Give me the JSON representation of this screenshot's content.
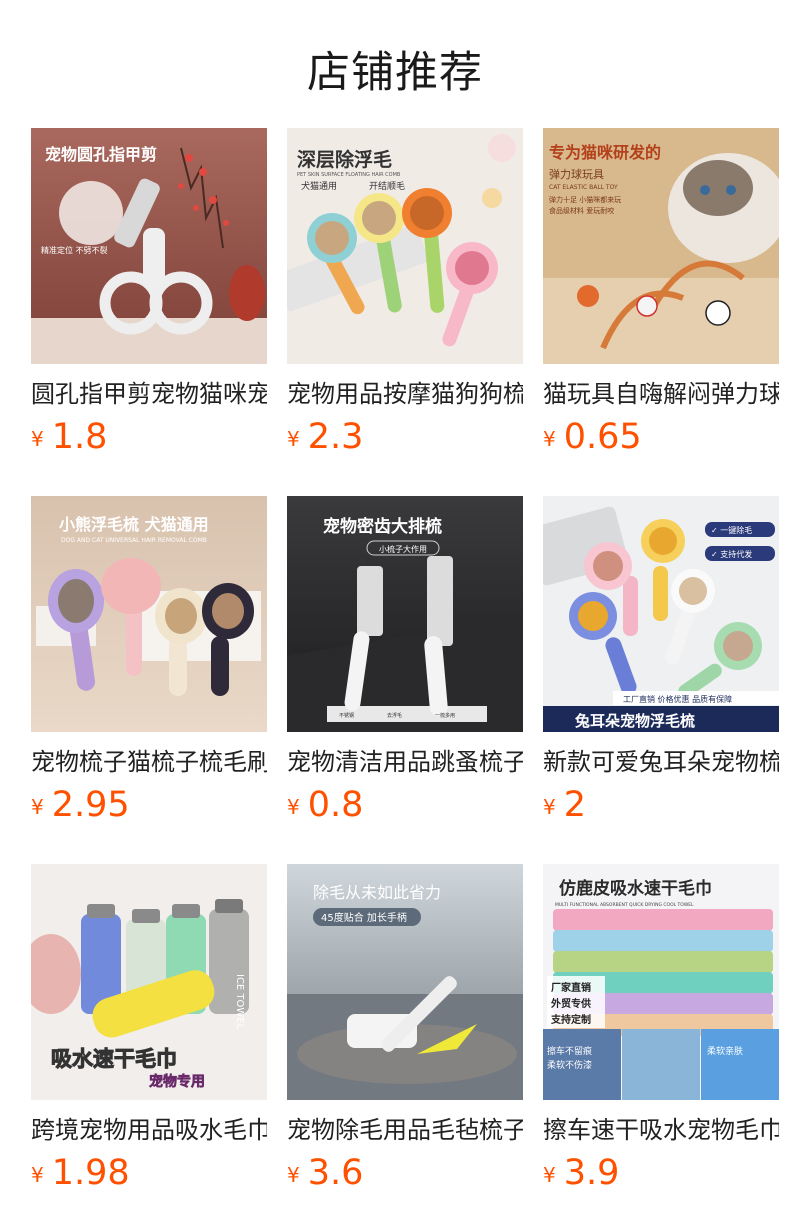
{
  "header": {
    "title": "店铺推荐"
  },
  "currency_symbol": "¥",
  "colors": {
    "price": "#ff5000"
  },
  "products": [
    {
      "name": "圆孔指甲剪宠物猫咪宠物用品",
      "price": "1.8",
      "image_text": [
        "宠物圆孔指甲剪",
        "精准定位 不劈不裂"
      ]
    },
    {
      "name": "宠物用品按摩猫狗狗梳子",
      "price": "2.3",
      "image_text": [
        "深层除浮毛",
        "PET SKIN SURFACE FLOATING HAIR COMB",
        "犬猫通用",
        "开结顺毛"
      ]
    },
    {
      "name": "猫玩具自嗨解闷弹力球",
      "price": "0.65",
      "image_text": [
        "专为猫咪研发的",
        "弹力球玩具",
        "CAT ELASTIC BALL TOY",
        "弹力十足 小猫咪都来玩",
        "食品级材料 爱玩耐咬"
      ]
    },
    {
      "name": "宠物梳子猫梳子梳毛刷",
      "price": "2.95",
      "image_text": [
        "小熊浮毛梳 犬猫通用",
        "DOG AND CAT UNIVERSAL HAIR REMOVAL COMB"
      ]
    },
    {
      "name": "宠物清洁用品跳蚤梳子",
      "price": "0.8",
      "image_text": [
        "宠物密齿大排梳",
        "小梳子大作用",
        "不锈钢",
        "去浮毛",
        "一梳多用"
      ]
    },
    {
      "name": "新款可爱兔耳朵宠物梳",
      "price": "2",
      "image_text": [
        "✓ 一键除毛",
        "✓ 支持代发",
        "工厂直销 价格优惠 品质有保障",
        "兔耳朵宠物浮毛梳"
      ]
    },
    {
      "name": "跨境宠物用品吸水毛巾",
      "price": "1.98",
      "image_text": [
        "ICE TOWEL",
        "吸水速干毛巾",
        "宠物专用"
      ]
    },
    {
      "name": "宠物除毛用品毛毡梳子",
      "price": "3.6",
      "image_text": [
        "除毛从未如此省力",
        "45度贴合 加长手柄"
      ]
    },
    {
      "name": "擦车速干吸水宠物毛巾",
      "price": "3.9",
      "image_text": [
        "仿鹿皮吸水速干毛巾",
        "MULTI FUNCTIONAL ABSORBENT QUICK DRYING COOL TOWEL",
        "厂家直销",
        "外贸专供",
        "支持定制",
        "擦车不留痕",
        "柔软不伤漆",
        "柔软亲肤"
      ]
    }
  ]
}
